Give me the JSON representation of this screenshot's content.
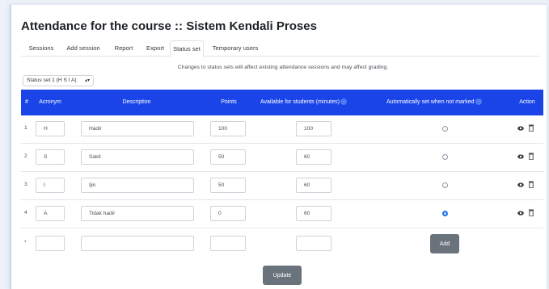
{
  "page": {
    "title": "Attendance for the course :: Sistem Kendali Proses"
  },
  "tabs": [
    {
      "label": "Sessions"
    },
    {
      "label": "Add session"
    },
    {
      "label": "Report"
    },
    {
      "label": "Export"
    },
    {
      "label": "Status set"
    },
    {
      "label": "Temporary users"
    }
  ],
  "notice": "Changes to status sets will affect existing attendance sessions and may affect grading.",
  "status_select": {
    "value": "Status set 1 (H S I A)"
  },
  "table": {
    "headers": {
      "index": "#",
      "acronym": "Acronym",
      "description": "Description",
      "points": "Points",
      "available": "Available for students (minutes)",
      "auto_set": "Automatically set when not marked",
      "action": "Action"
    },
    "rows": [
      {
        "num": "1",
        "acronym": "H",
        "description": "Hadir",
        "points": "100",
        "minutes": "100",
        "auto": false
      },
      {
        "num": "2",
        "acronym": "S",
        "description": "Sakit",
        "points": "50",
        "minutes": "60",
        "auto": false
      },
      {
        "num": "3",
        "acronym": "I",
        "description": "Ijin",
        "points": "50",
        "minutes": "60",
        "auto": false
      },
      {
        "num": "4",
        "acronym": "A",
        "description": "Tidak hadir",
        "points": "0",
        "minutes": "60",
        "auto": true
      }
    ],
    "new_row": {
      "num": "*"
    }
  },
  "buttons": {
    "add": "Add",
    "update": "Update"
  },
  "colors": {
    "header_bg": "#1a44e8",
    "button_bg": "#6a737b",
    "radio_checked": "#1a73e8"
  },
  "icons": {
    "visibility": "eye-icon",
    "delete": "trash-icon",
    "help": "help-icon"
  }
}
